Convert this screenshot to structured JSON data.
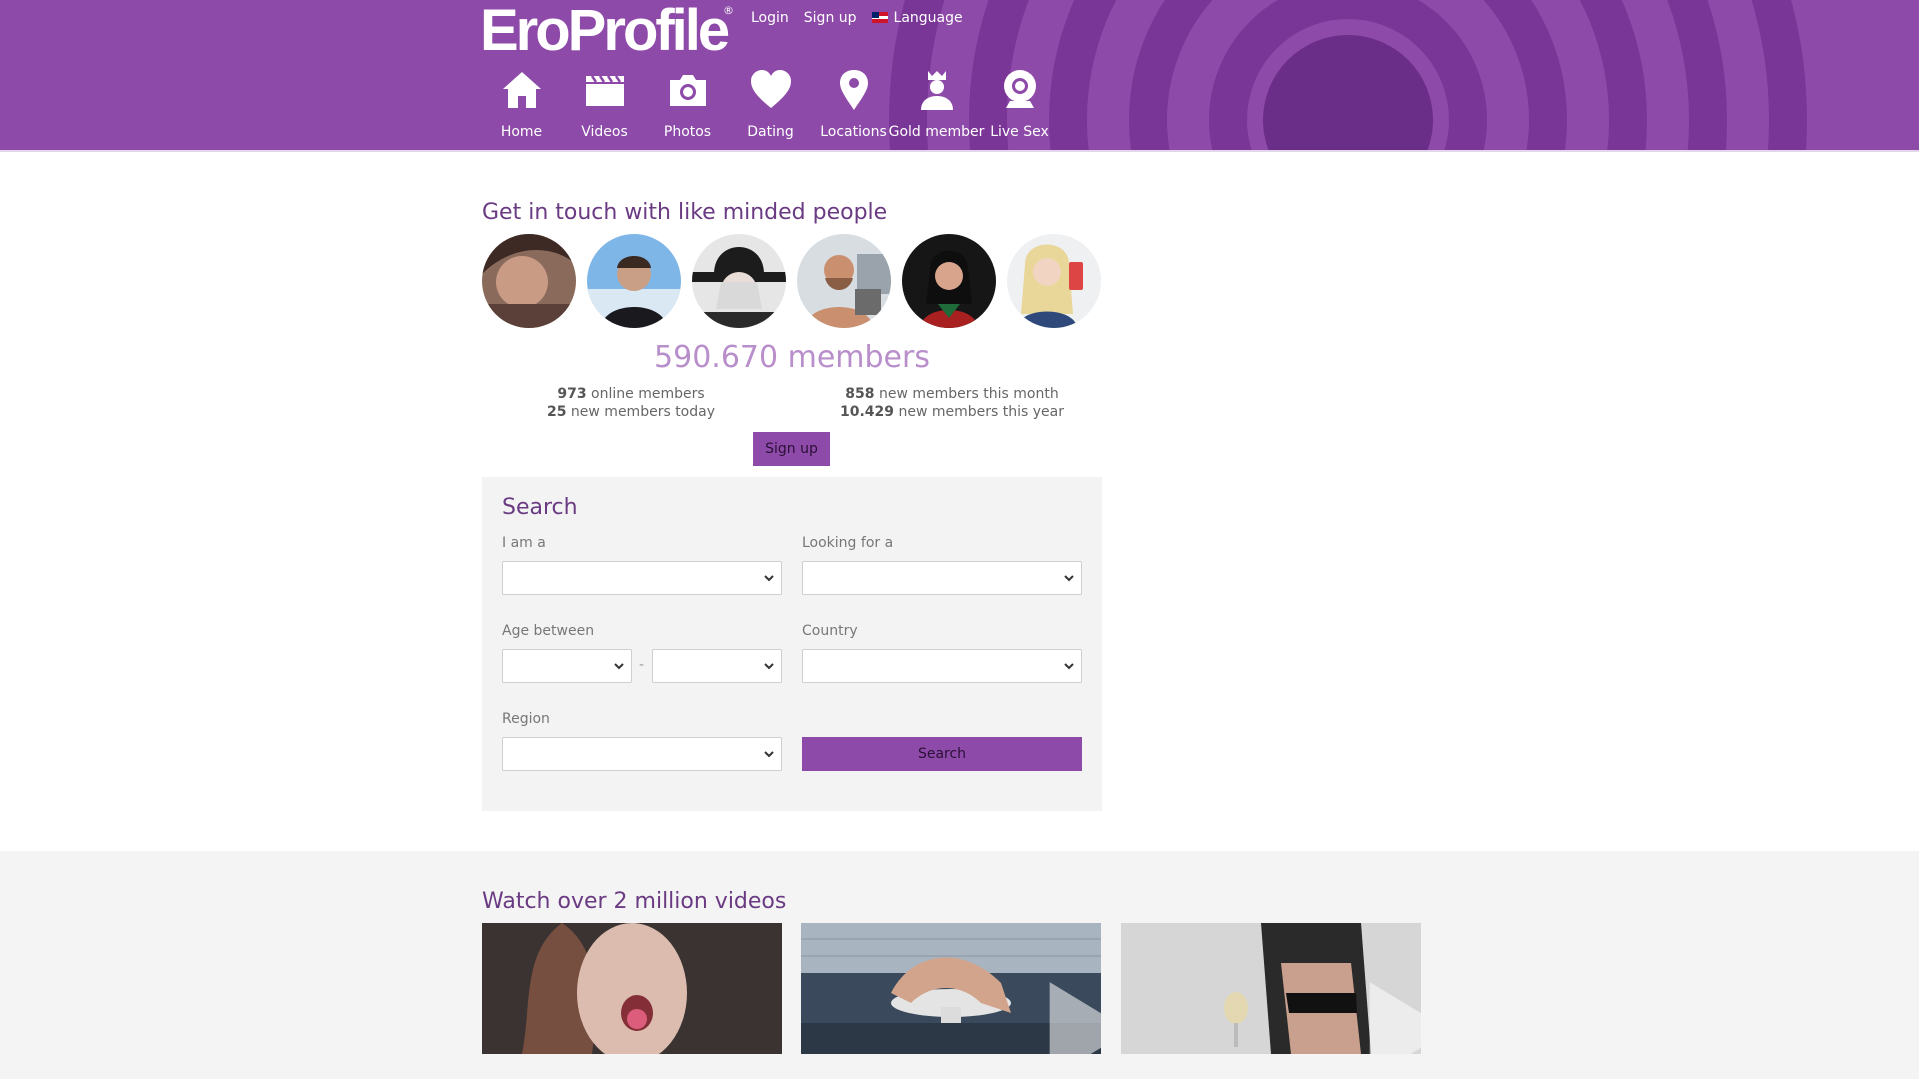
{
  "header": {
    "logo": "EroProfile",
    "logo_mark": "®",
    "top_links": {
      "login": "Login",
      "signup": "Sign up",
      "language": "Language"
    },
    "nav": [
      {
        "label": "Home",
        "icon": "home-icon"
      },
      {
        "label": "Videos",
        "icon": "clapperboard-icon"
      },
      {
        "label": "Photos",
        "icon": "camera-icon"
      },
      {
        "label": "Dating",
        "icon": "heart-icon"
      },
      {
        "label": "Locations",
        "icon": "map-pin-icon"
      },
      {
        "label": "Gold member",
        "icon": "crown-user-icon"
      },
      {
        "label": "Live Sex",
        "icon": "webcam-icon"
      }
    ]
  },
  "community": {
    "title": "Get in touch with like minded people",
    "avatars": [
      "avatar-1",
      "avatar-2",
      "avatar-3",
      "avatar-4",
      "avatar-5",
      "avatar-6"
    ],
    "members_total": "590.670 members",
    "online_count": "973",
    "online_text": " online members",
    "today_count": "25",
    "today_text": " new members today",
    "month_count": "858",
    "month_text": " new members this month",
    "year_count": "10.429",
    "year_text": " new members this year",
    "signup_button": "Sign up"
  },
  "search": {
    "title": "Search",
    "i_am_label": "I am a",
    "looking_label": "Looking for a",
    "age_label": "Age between",
    "age_dash": "-",
    "country_label": "Country",
    "region_label": "Region",
    "button": "Search"
  },
  "videos": {
    "title": "Watch over 2 million videos"
  },
  "colors": {
    "brand_purple": "#8e4aa8",
    "heading_purple": "#6a3a82",
    "count_lavender": "#b98fcb"
  }
}
